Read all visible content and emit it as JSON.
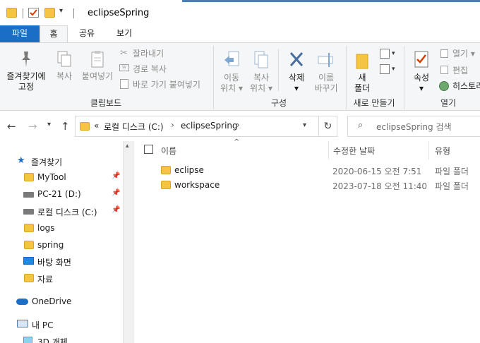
{
  "title": "eclipseSpring",
  "tabs": {
    "file": "파일",
    "home": "홈",
    "share": "공유",
    "view": "보기"
  },
  "ribbon": {
    "clipboard": {
      "pin_quick": [
        "즐겨찾기에",
        "고정"
      ],
      "copy": "복사",
      "paste": "붙여넣기",
      "cut": "잘라내기",
      "copy_path": "경로 복사",
      "paste_shortcut": "바로 가기 붙여넣기",
      "label": "클립보드"
    },
    "organize": {
      "move_to": [
        "이동",
        "위치"
      ],
      "copy_to": [
        "복사",
        "위치"
      ],
      "delete": "삭제",
      "rename": [
        "이름",
        "바꾸기"
      ],
      "label": "구성"
    },
    "new": {
      "new_folder": [
        "새",
        "폴더"
      ],
      "label": "새로 만들기"
    },
    "open": {
      "properties": "속성",
      "open": "열기",
      "edit": "편집",
      "history": "히스토리",
      "label": "열기"
    }
  },
  "address": {
    "prefix": "«",
    "crumbs": [
      "로컬 디스크 (C:)",
      "eclipseSpring"
    ]
  },
  "search": {
    "placeholder": "eclipseSpring 검색"
  },
  "nav": {
    "quick_access": "즐겨찾기",
    "items": [
      "MyTool",
      "PC-21 (D:)",
      "로컬 디스크 (C:)",
      "logs",
      "spring",
      "바탕 화면",
      "자료"
    ],
    "onedrive": "OneDrive",
    "this_pc": "내 PC",
    "objects_3d": "3D 개체"
  },
  "columns": {
    "name": "이름",
    "modified": "수정한 날짜",
    "type": "유형"
  },
  "files": [
    {
      "name": "eclipse",
      "modified": "2020-06-15 오전 7:51",
      "type": "파일 폴더"
    },
    {
      "name": "workspace",
      "modified": "2023-07-18 오전 11:40",
      "type": "파일 폴더"
    }
  ],
  "colors": {
    "file_tab": "#1a6fc4",
    "folder": "#f5c443",
    "accent": "#4a7fb5"
  }
}
